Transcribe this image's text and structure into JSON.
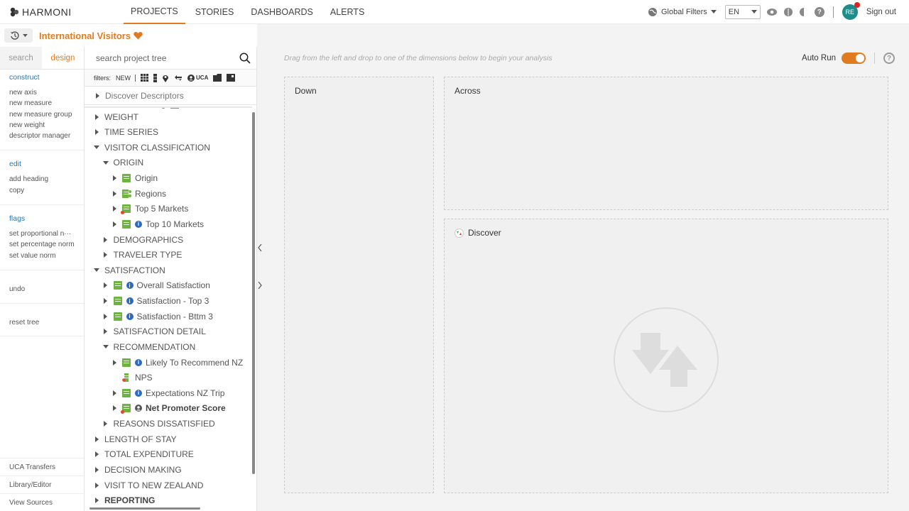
{
  "brand": {
    "logo_text": "HARMONI"
  },
  "nav": {
    "tabs": [
      {
        "label": "PROJECTS",
        "active": true
      },
      {
        "label": "STORIES",
        "active": false
      },
      {
        "label": "DASHBOARDS",
        "active": false
      },
      {
        "label": "ALERTS",
        "active": false
      }
    ]
  },
  "topbar": {
    "global_filters": "Global Filters",
    "language": "EN",
    "user_initials": "RE",
    "sign_out": "Sign out"
  },
  "project": {
    "title": "International Visitors"
  },
  "sidebar": {
    "tabs": [
      {
        "label": "search",
        "active": false
      },
      {
        "label": "design",
        "active": true
      }
    ],
    "sections": [
      {
        "heading": "construct",
        "items": [
          "new axis",
          "new measure",
          "new measure group",
          "new weight",
          "descriptor manager"
        ]
      },
      {
        "heading": "edit",
        "items": [
          "add heading",
          "copy"
        ]
      },
      {
        "heading": "flags",
        "items": [
          "set proportional n···",
          "set percentage norm",
          "set value norm"
        ]
      }
    ],
    "undo": "undo",
    "reset_tree": "reset tree",
    "bottom": [
      "UCA Transfers",
      "Library/Editor",
      "View Sources"
    ]
  },
  "tree": {
    "search_placeholder": "search project tree",
    "filters_label": "filters:",
    "filters_new": "NEW",
    "filters_uca": "UCA",
    "discover_descriptors": "Discover Descriptors",
    "rows": [
      {
        "label": "WEIGHT",
        "level": 0,
        "caret": "right"
      },
      {
        "label": "TIME SERIES",
        "level": 0,
        "caret": "right"
      },
      {
        "label": "VISITOR CLASSIFICATION",
        "level": 0,
        "caret": "down"
      },
      {
        "label": "ORIGIN",
        "level": 1,
        "caret": "down"
      },
      {
        "label": "Origin",
        "level": 2,
        "caret": "right",
        "icon": "variable-icon"
      },
      {
        "label": "Regions",
        "level": 2,
        "caret": "right",
        "icon": "regions-icon"
      },
      {
        "label": "Top 5 Markets",
        "level": 2,
        "caret": "right",
        "icon": "variable-derived-icon"
      },
      {
        "label": "Top 10 Markets",
        "level": 2,
        "caret": "right",
        "icon": "variable-icon",
        "info": true
      },
      {
        "label": "DEMOGRAPHICS",
        "level": 1,
        "caret": "right"
      },
      {
        "label": "TRAVELER TYPE",
        "level": 1,
        "caret": "right"
      },
      {
        "label": "SATISFACTION",
        "level": 0,
        "caret": "down"
      },
      {
        "label": "Overall Satisfaction",
        "level": 1,
        "caret": "right",
        "icon": "variable-icon",
        "info": true
      },
      {
        "label": "Satisfaction - Top 3",
        "level": 1,
        "caret": "right",
        "icon": "variable-icon",
        "info": true
      },
      {
        "label": "Satisfaction - Bttm 3",
        "level": 1,
        "caret": "right",
        "icon": "variable-icon",
        "info": true
      },
      {
        "label": "SATISFACTION DETAIL",
        "level": 1,
        "caret": "right"
      },
      {
        "label": "RECOMMENDATION",
        "level": 1,
        "caret": "down"
      },
      {
        "label": "Likely To Recommend NZ",
        "level": 2,
        "caret": "right",
        "icon": "variable-icon",
        "info": true
      },
      {
        "label": "NPS",
        "level": 2,
        "caret": "none",
        "icon": "nps-icon"
      },
      {
        "label": "Expectations NZ Trip",
        "level": 2,
        "caret": "right",
        "icon": "variable-icon",
        "info": true
      },
      {
        "label": "Net Promoter Score",
        "level": 2,
        "caret": "right",
        "icon": "variable-derived-icon",
        "uca": true,
        "bold": true
      },
      {
        "label": "REASONS DISSATISFIED",
        "level": 1,
        "caret": "right"
      },
      {
        "label": "LENGTH OF STAY",
        "level": 0,
        "caret": "right"
      },
      {
        "label": "TOTAL EXPENDITURE",
        "level": 0,
        "caret": "right"
      },
      {
        "label": "DECISION MAKING",
        "level": 0,
        "caret": "right"
      },
      {
        "label": "VISIT TO NEW ZEALAND",
        "level": 0,
        "caret": "right"
      },
      {
        "label": "REPORTING",
        "level": 0,
        "caret": "right",
        "bold": true
      }
    ]
  },
  "main": {
    "hint": "Drag from the left and drop to one of the dimensions below to begin your analysis",
    "auto_run_label": "Auto Run",
    "auto_run_on": true,
    "zones": {
      "down": "Down",
      "across": "Across",
      "discover": "Discover"
    }
  },
  "colors": {
    "accent": "#e07b22",
    "variable_green": "#6db33f",
    "info_blue": "#2a6bbf"
  }
}
